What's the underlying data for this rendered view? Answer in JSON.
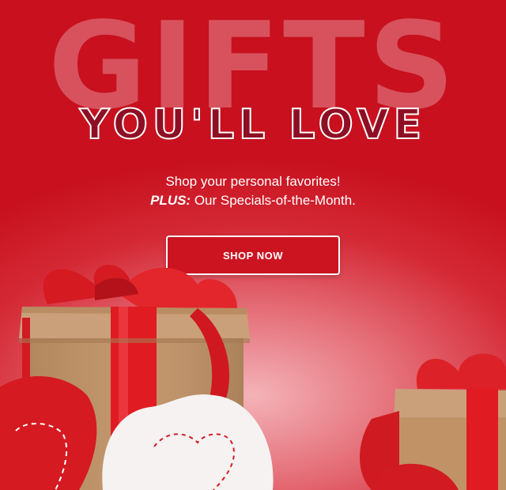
{
  "hero": {
    "headline": "GIFTS",
    "subheadline": "YOU'LL LOVE",
    "tagline_line1": "Shop your personal favorites!",
    "tagline_plus": "PLUS:",
    "tagline_line2": " Our Specials-of-the-Month.",
    "cta_label": "SHOP NOW"
  },
  "colors": {
    "background": "#c8101e",
    "accent_dark": "#8e0f24",
    "button": "#cc1421",
    "gift_box": "#c9a07a",
    "ribbon": "#e01b22"
  },
  "illustration": {
    "items": [
      "gift-box-left",
      "gift-box-right",
      "red-felt-heart",
      "white-felt-heart"
    ]
  }
}
